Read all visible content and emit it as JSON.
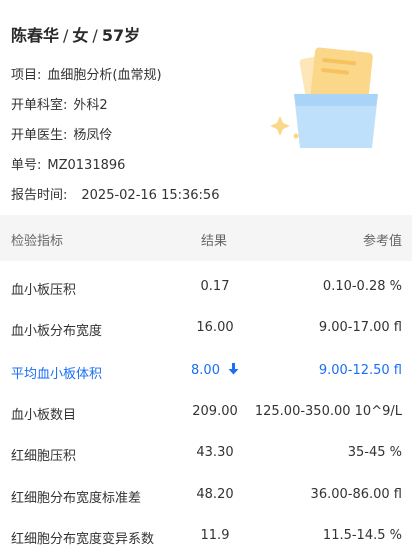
{
  "patient": {
    "name": "陈春华",
    "sep1": "/",
    "gender": "女",
    "sep2": "/",
    "age": "57岁"
  },
  "info": [
    {
      "label": "项目:",
      "value": "血细胞分析(血常规)"
    },
    {
      "label": "开单科室:",
      "value": "外科2"
    },
    {
      "label": "开单医生:",
      "value": "杨凤伶"
    },
    {
      "label": "单号:",
      "value": "MZ0131896"
    },
    {
      "label": "报告时间:",
      "value": "2025-02-16 15:36:56"
    }
  ],
  "table": {
    "headers": {
      "indicator": "检验指标",
      "result": "结果",
      "reference": "参考值"
    },
    "rows": [
      {
        "name": "血小板压积",
        "result": "0.17",
        "reference": "0.10-0.28 %",
        "abnormal": false
      },
      {
        "name": "血小板分布宽度",
        "result": "16.00",
        "reference": "9.00-17.00 fl",
        "abnormal": false
      },
      {
        "name": "平均血小板体积",
        "result": "8.00",
        "reference": "9.00-12.50 fl",
        "abnormal": true,
        "flag": "down-arrow-icon"
      },
      {
        "name": "血小板数目",
        "result": "209.00",
        "reference": "125.00-350.00 10^9/L",
        "abnormal": false
      },
      {
        "name": "红细胞压积",
        "result": "43.30",
        "reference": "35-45 %",
        "abnormal": false
      },
      {
        "name": "红细胞分布宽度标准差",
        "result": "48.20",
        "reference": "36.00-86.00 fl",
        "abnormal": false
      },
      {
        "name": "红细胞分布宽度变异系数",
        "result": "11.9",
        "reference": "11.5-14.5 %",
        "abnormal": false
      }
    ]
  },
  "colors": {
    "abnormal": "#1a6ff5",
    "header_bg": "#f5f5f5"
  }
}
